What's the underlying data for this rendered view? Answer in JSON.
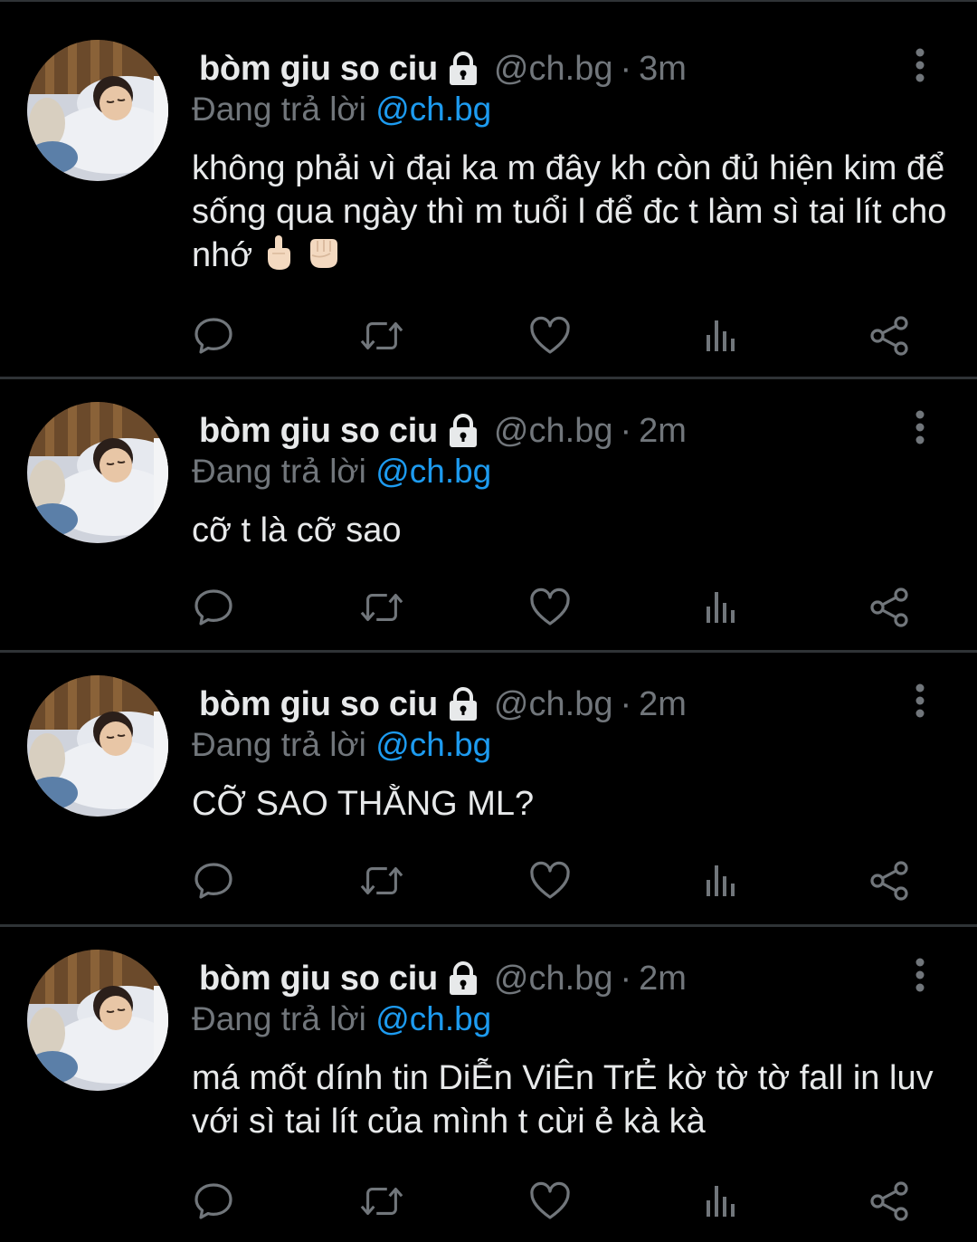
{
  "colors": {
    "background": "#000000",
    "text": "#e7e9ea",
    "secondary": "#71767b",
    "mention": "#1d9bf0",
    "divider": "#2f3336"
  },
  "tweets": [
    {
      "display_name": "bòm giu so ciu",
      "handle": "@ch.bg",
      "separator": "·",
      "time": "3m",
      "reply_prefix": "Đang trả lời",
      "reply_handle": "@ch.bg",
      "text": "không phải vì đại ka m đây kh còn đủ hiện kim để sống qua ngày thì m tuổi l để đc t làm sì tai lít cho nhớ",
      "emojis": [
        "middle-finger-emoji",
        "fist-emoji"
      ]
    },
    {
      "display_name": "bòm giu so ciu",
      "handle": "@ch.bg",
      "separator": "·",
      "time": "2m",
      "reply_prefix": "Đang trả lời",
      "reply_handle": "@ch.bg",
      "text": "cỡ t là cỡ sao",
      "emojis": []
    },
    {
      "display_name": "bòm giu so ciu",
      "handle": "@ch.bg",
      "separator": "·",
      "time": "2m",
      "reply_prefix": "Đang trả lời",
      "reply_handle": "@ch.bg",
      "text": "CỠ SAO THẰNG ML?",
      "emojis": []
    },
    {
      "display_name": "bòm giu so ciu",
      "handle": "@ch.bg",
      "separator": "·",
      "time": "2m",
      "reply_prefix": "Đang trả lời",
      "reply_handle": "@ch.bg",
      "text": "má mốt dính tin DiỄn ViÊn TrẺ kờ tờ tờ fall in luv với sì tai lít của mình t cừi ẻ kà kà",
      "emojis": []
    }
  ],
  "action_icons": [
    "reply-icon",
    "retweet-icon",
    "like-icon",
    "views-icon",
    "share-icon"
  ]
}
